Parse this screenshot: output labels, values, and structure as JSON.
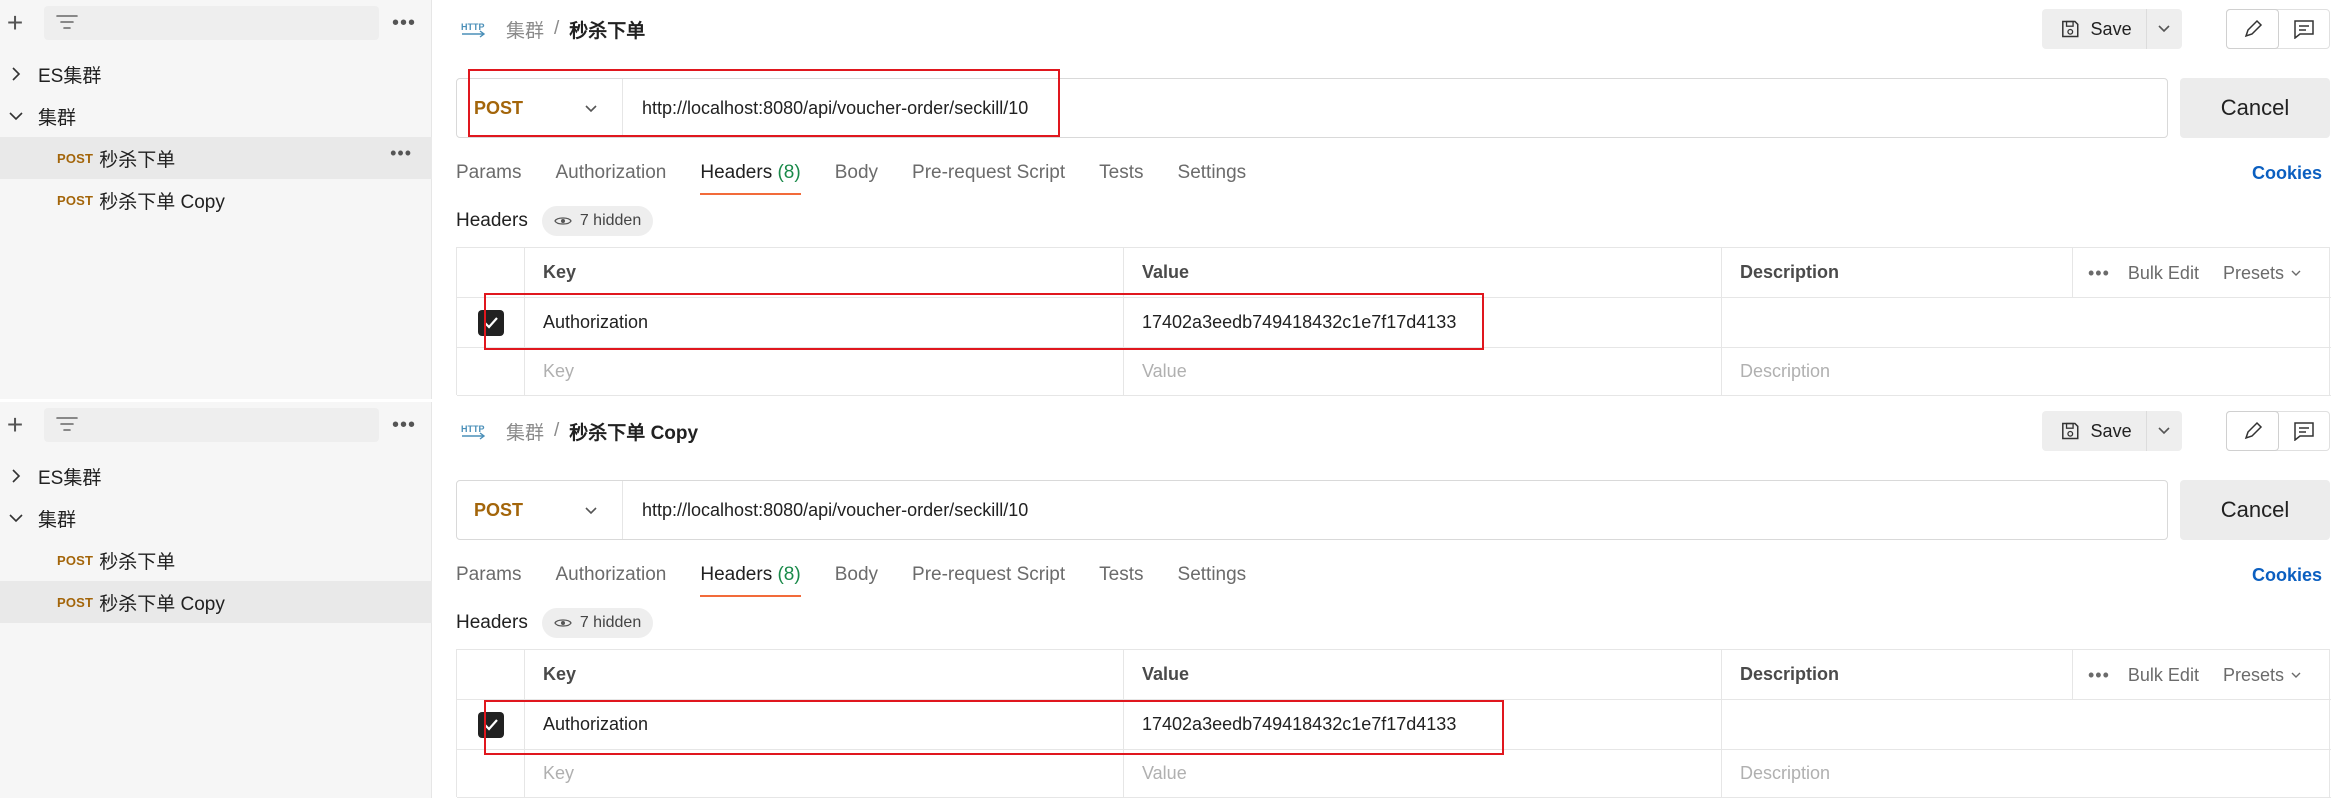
{
  "panels": [
    {
      "sidebar": {
        "add_symbol": "+",
        "more_symbol": "•••",
        "items": [
          {
            "label": "ES集群"
          },
          {
            "label": "集群"
          },
          {
            "method": "POST",
            "label": "秒杀下单",
            "more": "•••"
          },
          {
            "method": "POST",
            "label": "秒杀下单 Copy"
          }
        ]
      },
      "breadcrumb": {
        "collection": "集群",
        "separator": "/",
        "request": "秒杀下单"
      },
      "toolbar": {
        "save_label": "Save"
      },
      "request": {
        "method": "POST",
        "url": "http://localhost:8080/api/voucher-order/seckill/10",
        "cancel_label": "Cancel"
      },
      "tabs": {
        "params": "Params",
        "authorization": "Authorization",
        "headers": "Headers",
        "headers_count": "(8)",
        "body": "Body",
        "prerequest": "Pre-request Script",
        "tests": "Tests",
        "settings": "Settings",
        "cookies": "Cookies"
      },
      "headers": {
        "title": "Headers",
        "hidden": "7 hidden",
        "columns": {
          "key": "Key",
          "value": "Value",
          "description": "Description"
        },
        "actions": {
          "dots": "•••",
          "bulk_edit": "Bulk Edit",
          "presets": "Presets"
        },
        "row": {
          "key": "Authorization",
          "value": "17402a3eedb749418432c1e7f17d4133"
        },
        "placeholders": {
          "key": "Key",
          "value": "Value",
          "description": "Description"
        }
      }
    },
    {
      "sidebar": {
        "add_symbol": "+",
        "more_symbol": "•••",
        "items": [
          {
            "label": "ES集群"
          },
          {
            "label": "集群"
          },
          {
            "method": "POST",
            "label": "秒杀下单"
          },
          {
            "method": "POST",
            "label": "秒杀下单 Copy"
          }
        ]
      },
      "breadcrumb": {
        "collection": "集群",
        "separator": "/",
        "request": "秒杀下单 Copy"
      },
      "toolbar": {
        "save_label": "Save"
      },
      "request": {
        "method": "POST",
        "url": "http://localhost:8080/api/voucher-order/seckill/10",
        "cancel_label": "Cancel"
      },
      "tabs": {
        "params": "Params",
        "authorization": "Authorization",
        "headers": "Headers",
        "headers_count": "(8)",
        "body": "Body",
        "prerequest": "Pre-request Script",
        "tests": "Tests",
        "settings": "Settings",
        "cookies": "Cookies"
      },
      "headers": {
        "title": "Headers",
        "hidden": "7 hidden",
        "columns": {
          "key": "Key",
          "value": "Value",
          "description": "Description"
        },
        "actions": {
          "dots": "•••",
          "bulk_edit": "Bulk Edit",
          "presets": "Presets"
        },
        "row": {
          "key": "Authorization",
          "value": "17402a3eedb749418432c1e7f17d4133"
        },
        "placeholders": {
          "key": "Key",
          "value": "Value",
          "description": "Description"
        }
      }
    }
  ],
  "colors": {
    "method": "#a3650a",
    "accent_tab": "#f26b3a",
    "count": "#1a8a4a",
    "link": "#0b5fc0",
    "highlight": "#e0171e"
  },
  "icons": [
    "http-icon",
    "filter-icon",
    "save-icon",
    "pencil-icon",
    "comment-icon",
    "eye-icon",
    "chevron-right-icon",
    "chevron-down-icon",
    "checkmark-icon"
  ]
}
